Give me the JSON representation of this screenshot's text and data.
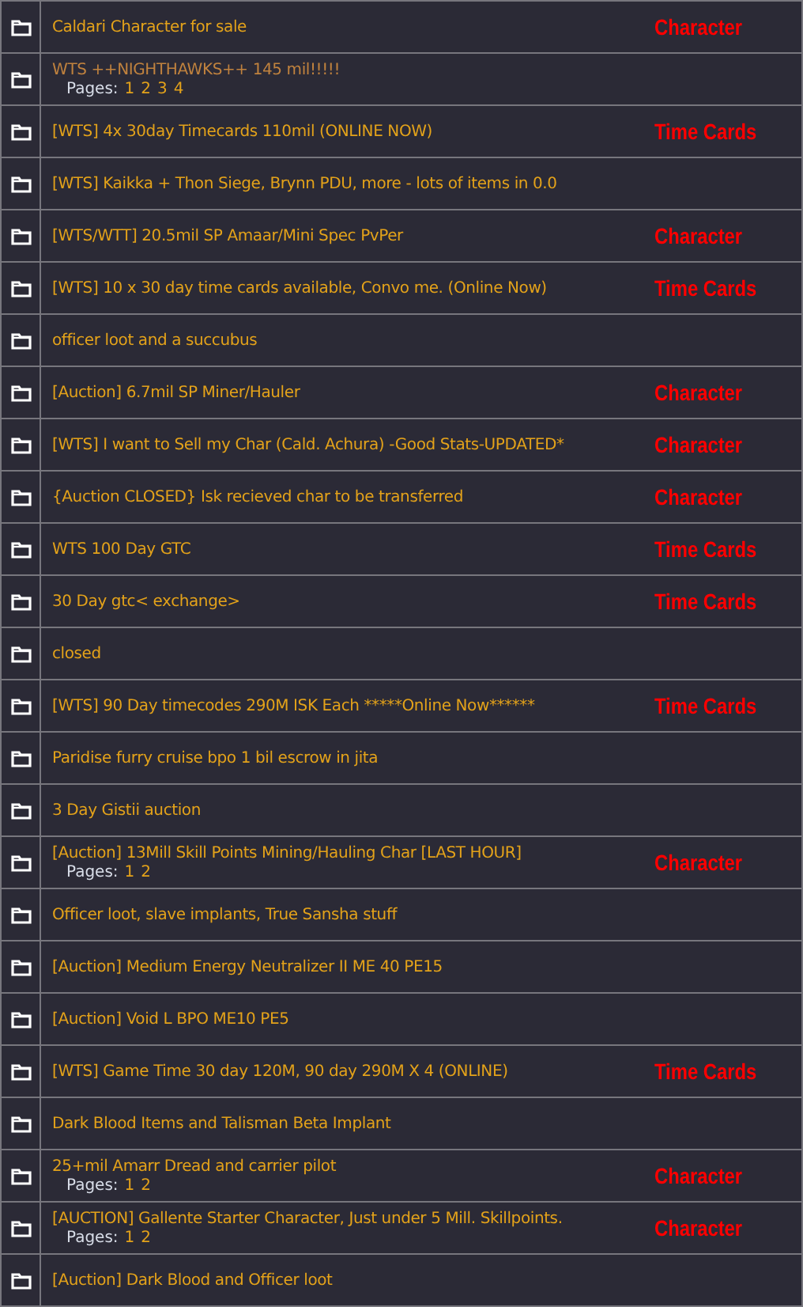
{
  "topics": [
    {
      "title": "Caldari Character for sale",
      "visited": false,
      "tag": "Character"
    },
    {
      "title": "WTS ++NIGHTHAWKS++ 145 mil!!!!!",
      "visited": true,
      "pages_label": "Pages:",
      "pages": [
        "1",
        "2",
        "3",
        "4"
      ]
    },
    {
      "title": "[WTS] 4x 30day Timecards 110mil (ONLINE NOW)",
      "visited": false,
      "tag": "Time Cards"
    },
    {
      "title": "[WTS] Kaikka + Thon Siege, Brynn PDU, more - lots of items in 0.0",
      "visited": false
    },
    {
      "title": "[WTS/WTT] 20.5mil SP Amaar/Mini Spec PvPer",
      "visited": false,
      "tag": "Character"
    },
    {
      "title": "[WTS] 10 x 30 day time cards available, Convo me. (Online Now)",
      "visited": false,
      "tag": "Time Cards"
    },
    {
      "title": "officer loot and a succubus",
      "visited": false
    },
    {
      "title": "[Auction] 6.7mil SP Miner/Hauler",
      "visited": false,
      "tag": "Character"
    },
    {
      "title": "[WTS] I want to Sell my Char (Cald. Achura) -Good Stats-UPDATED*",
      "visited": false,
      "tag": "Character"
    },
    {
      "title": "{Auction CLOSED} Isk recieved char to be transferred",
      "visited": false,
      "tag": "Character"
    },
    {
      "title": "WTS 100 Day GTC",
      "visited": false,
      "tag": "Time Cards"
    },
    {
      "title": "30 Day gtc< exchange>",
      "visited": false,
      "tag": "Time Cards"
    },
    {
      "title": "closed",
      "visited": false
    },
    {
      "title": "[WTS] 90 Day timecodes 290M ISK Each *****Online Now******",
      "visited": false,
      "tag": "Time Cards"
    },
    {
      "title": "Paridise furry cruise bpo 1 bil escrow in jita",
      "visited": false
    },
    {
      "title": "3 Day Gistii auction",
      "visited": false
    },
    {
      "title": "[Auction] 13Mill Skill Points Mining/Hauling Char [LAST HOUR]",
      "visited": false,
      "pages_label": "Pages:",
      "pages": [
        "1",
        "2"
      ],
      "tag": "Character"
    },
    {
      "title": "Officer loot, slave implants, True Sansha stuff",
      "visited": false
    },
    {
      "title": "[Auction] Medium Energy Neutralizer II ME 40 PE15",
      "visited": false
    },
    {
      "title": "[Auction] Void L BPO ME10 PE5",
      "visited": false
    },
    {
      "title": "[WTS] Game Time 30 day 120M, 90 day 290M X 4 (ONLINE)",
      "visited": false,
      "tag": "Time Cards"
    },
    {
      "title": "Dark Blood Items and Talisman Beta Implant",
      "visited": false
    },
    {
      "title": "25+mil Amarr Dread and carrier pilot",
      "visited": false,
      "pages_label": "Pages:",
      "pages": [
        "1",
        "2"
      ],
      "tag": "Character"
    },
    {
      "title": "[AUCTION] Gallente Starter Character, Just under 5 Mill. Skillpoints.",
      "visited": false,
      "pages_label": "Pages:",
      "pages": [
        "1",
        "2"
      ],
      "tag": "Character"
    },
    {
      "title": "[Auction] Dark Blood and Officer loot",
      "visited": false
    }
  ]
}
